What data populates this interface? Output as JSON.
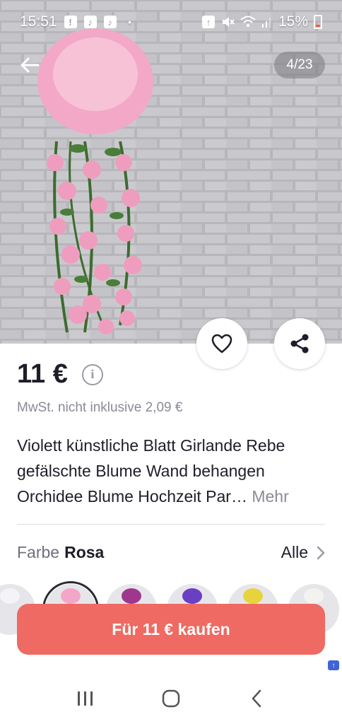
{
  "status_bar": {
    "time": "15:51",
    "battery": "15%",
    "icons": [
      "alert-icon",
      "tiktok-icon",
      "tiktok-icon",
      "dot-icon",
      "upload-icon",
      "mute-icon",
      "wifi-icon",
      "signal-icon",
      "battery-icon"
    ]
  },
  "gallery": {
    "counter": "4/23",
    "image_icon": "hanging-flower-garland-image"
  },
  "product": {
    "price": "11 €",
    "vat_note": "MwSt. nicht inklusive 2,09 €",
    "title": "Violett künstliche Blatt Girlande Rebe gefälschte Blume Wand behangen Orchidee Blume Hochzeit Par…",
    "more_label": "Mehr"
  },
  "variant": {
    "label": "Farbe",
    "selected": "Rosa",
    "all_label": "Alle",
    "swatch_colors": [
      "#f4f4f6",
      "#f3a6c8",
      "#a0378f",
      "#6a3fc3",
      "#e7d43c",
      "#f2f2ee"
    ]
  },
  "cta": {
    "buy_label": "Für 11 € kaufen",
    "color": "#ee6a62"
  }
}
